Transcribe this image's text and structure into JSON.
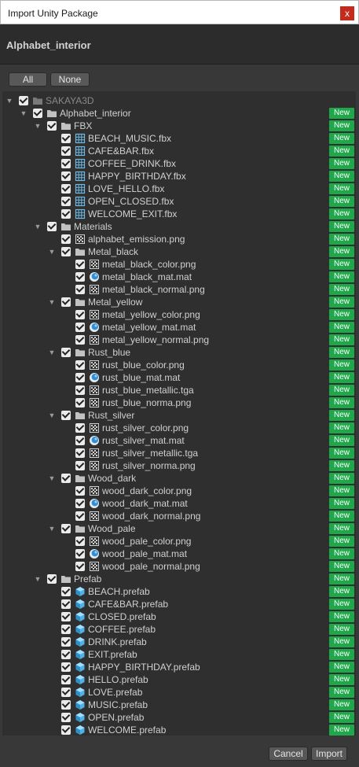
{
  "window": {
    "title": "Import Unity Package",
    "close_glyph": "x"
  },
  "package_name": "Alphabet_interior",
  "toolbar": {
    "all_label": "All",
    "none_label": "None"
  },
  "badge_text": "New",
  "tree": [
    {
      "label": "SAKAYA3D",
      "icon": "folder-icon",
      "depth": 0,
      "expandable": true,
      "root": true,
      "badge": false
    },
    {
      "label": "Alphabet_interior",
      "icon": "folder-icon",
      "depth": 1,
      "expandable": true,
      "badge": true
    },
    {
      "label": "FBX",
      "icon": "folder-icon",
      "depth": 2,
      "expandable": true,
      "badge": true
    },
    {
      "label": "BEACH_MUSIC.fbx",
      "icon": "mesh-icon",
      "depth": 3,
      "badge": true
    },
    {
      "label": "CAFE&BAR.fbx",
      "icon": "mesh-icon",
      "depth": 3,
      "badge": true
    },
    {
      "label": "COFFEE_DRINK.fbx",
      "icon": "mesh-icon",
      "depth": 3,
      "badge": true
    },
    {
      "label": "HAPPY_BIRTHDAY.fbx",
      "icon": "mesh-icon",
      "depth": 3,
      "badge": true
    },
    {
      "label": "LOVE_HELLO.fbx",
      "icon": "mesh-icon",
      "depth": 3,
      "badge": true
    },
    {
      "label": "OPEN_CLOSED.fbx",
      "icon": "mesh-icon",
      "depth": 3,
      "badge": true
    },
    {
      "label": "WELCOME_EXIT.fbx",
      "icon": "mesh-icon",
      "depth": 3,
      "badge": true
    },
    {
      "label": "Materials",
      "icon": "folder-icon",
      "depth": 2,
      "expandable": true,
      "badge": true
    },
    {
      "label": "alphabet_emission.png",
      "icon": "texture-icon",
      "depth": 3,
      "badge": true
    },
    {
      "label": "Metal_black",
      "icon": "folder-icon",
      "depth": 3,
      "expandable": true,
      "badge": true
    },
    {
      "label": "metal_black_color.png",
      "icon": "texture-icon",
      "depth": 4,
      "badge": true
    },
    {
      "label": "metal_black_mat.mat",
      "icon": "material-icon",
      "depth": 4,
      "badge": true
    },
    {
      "label": "metal_black_normal.png",
      "icon": "texture-icon",
      "depth": 4,
      "badge": true
    },
    {
      "label": "Metal_yellow",
      "icon": "folder-icon",
      "depth": 3,
      "expandable": true,
      "badge": true
    },
    {
      "label": "metal_yellow_color.png",
      "icon": "texture-icon",
      "depth": 4,
      "badge": true
    },
    {
      "label": "metal_yellow_mat.mat",
      "icon": "material-icon",
      "depth": 4,
      "badge": true
    },
    {
      "label": "metal_yellow_normal.png",
      "icon": "texture-icon",
      "depth": 4,
      "badge": true
    },
    {
      "label": "Rust_blue",
      "icon": "folder-icon",
      "depth": 3,
      "expandable": true,
      "badge": true
    },
    {
      "label": "rust_blue_color.png",
      "icon": "texture-icon",
      "depth": 4,
      "badge": true
    },
    {
      "label": "rust_blue_mat.mat",
      "icon": "material-icon",
      "depth": 4,
      "badge": true
    },
    {
      "label": "rust_blue_metallic.tga",
      "icon": "texture-icon",
      "depth": 4,
      "badge": true
    },
    {
      "label": "rust_blue_norma.png",
      "icon": "texture-icon",
      "depth": 4,
      "badge": true
    },
    {
      "label": "Rust_silver",
      "icon": "folder-icon",
      "depth": 3,
      "expandable": true,
      "badge": true
    },
    {
      "label": "rust_silver_color.png",
      "icon": "texture-icon",
      "depth": 4,
      "badge": true
    },
    {
      "label": "rust_silver_mat.mat",
      "icon": "material-icon",
      "depth": 4,
      "badge": true
    },
    {
      "label": "rust_silver_metallic.tga",
      "icon": "texture-icon",
      "depth": 4,
      "badge": true
    },
    {
      "label": "rust_silver_norma.png",
      "icon": "texture-icon",
      "depth": 4,
      "badge": true
    },
    {
      "label": "Wood_dark",
      "icon": "folder-icon",
      "depth": 3,
      "expandable": true,
      "badge": true
    },
    {
      "label": "wood_dark_color.png",
      "icon": "texture-icon",
      "depth": 4,
      "badge": true
    },
    {
      "label": "wood_dark_mat.mat",
      "icon": "material-icon",
      "depth": 4,
      "badge": true
    },
    {
      "label": "wood_dark_normal.png",
      "icon": "texture-icon",
      "depth": 4,
      "badge": true
    },
    {
      "label": "Wood_pale",
      "icon": "folder-icon",
      "depth": 3,
      "expandable": true,
      "badge": true
    },
    {
      "label": "wood_pale_color.png",
      "icon": "texture-icon",
      "depth": 4,
      "badge": true
    },
    {
      "label": "wood_pale_mat.mat",
      "icon": "material-icon",
      "depth": 4,
      "badge": true
    },
    {
      "label": "wood_pale_normal.png",
      "icon": "texture-icon",
      "depth": 4,
      "badge": true
    },
    {
      "label": "Prefab",
      "icon": "folder-icon",
      "depth": 2,
      "expandable": true,
      "badge": true
    },
    {
      "label": "BEACH.prefab",
      "icon": "prefab-icon",
      "depth": 3,
      "badge": true
    },
    {
      "label": "CAFE&BAR.prefab",
      "icon": "prefab-icon",
      "depth": 3,
      "badge": true
    },
    {
      "label": "CLOSED.prefab",
      "icon": "prefab-icon",
      "depth": 3,
      "badge": true
    },
    {
      "label": "COFFEE.prefab",
      "icon": "prefab-icon",
      "depth": 3,
      "badge": true
    },
    {
      "label": "DRINK.prefab",
      "icon": "prefab-icon",
      "depth": 3,
      "badge": true
    },
    {
      "label": "EXIT.prefab",
      "icon": "prefab-icon",
      "depth": 3,
      "badge": true
    },
    {
      "label": "HAPPY_BIRTHDAY.prefab",
      "icon": "prefab-icon",
      "depth": 3,
      "badge": true
    },
    {
      "label": "HELLO.prefab",
      "icon": "prefab-icon",
      "depth": 3,
      "badge": true
    },
    {
      "label": "LOVE.prefab",
      "icon": "prefab-icon",
      "depth": 3,
      "badge": true
    },
    {
      "label": "MUSIC.prefab",
      "icon": "prefab-icon",
      "depth": 3,
      "badge": true
    },
    {
      "label": "OPEN.prefab",
      "icon": "prefab-icon",
      "depth": 3,
      "badge": true
    },
    {
      "label": "WELCOME.prefab",
      "icon": "prefab-icon",
      "depth": 3,
      "badge": true
    }
  ],
  "footer": {
    "cancel_label": "Cancel",
    "import_label": "Import"
  },
  "colors": {
    "new_badge": "#1ea84a",
    "close_button": "#c42b1c",
    "prefab_icon": "#4fb3e8",
    "background": "#383838"
  }
}
